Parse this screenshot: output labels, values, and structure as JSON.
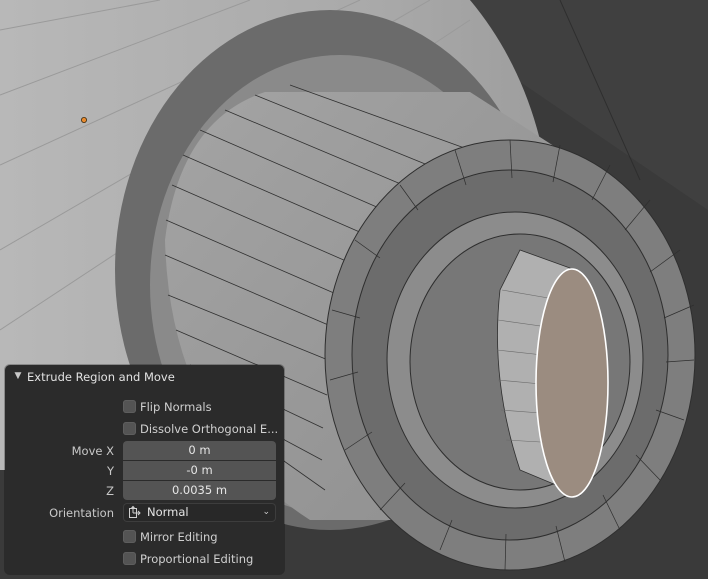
{
  "viewport": {
    "colors": {
      "background": "#3a3a3a",
      "selected_face": "#9b8c80",
      "selected_edge": "#ffffff",
      "origin_dot": "#e88a2e"
    }
  },
  "operator_panel": {
    "title": "Extrude Region and Move",
    "chevron_icon": "chevron-down-icon",
    "flip_normals": {
      "label": "Flip Normals",
      "checked": false
    },
    "dissolve_orthogonal": {
      "label": "Dissolve Orthogonal E...",
      "checked": false
    },
    "move": {
      "x_label": "Move X",
      "x_value": "0 m",
      "y_label": "Y",
      "y_value": "-0 m",
      "z_label": "Z",
      "z_value": "0.0035 m"
    },
    "orientation": {
      "label": "Orientation",
      "value": "Normal",
      "icon": "orientation-normal-icon"
    },
    "mirror_editing": {
      "label": "Mirror Editing",
      "checked": false
    },
    "proportional_editing": {
      "label": "Proportional Editing",
      "checked": false
    }
  }
}
